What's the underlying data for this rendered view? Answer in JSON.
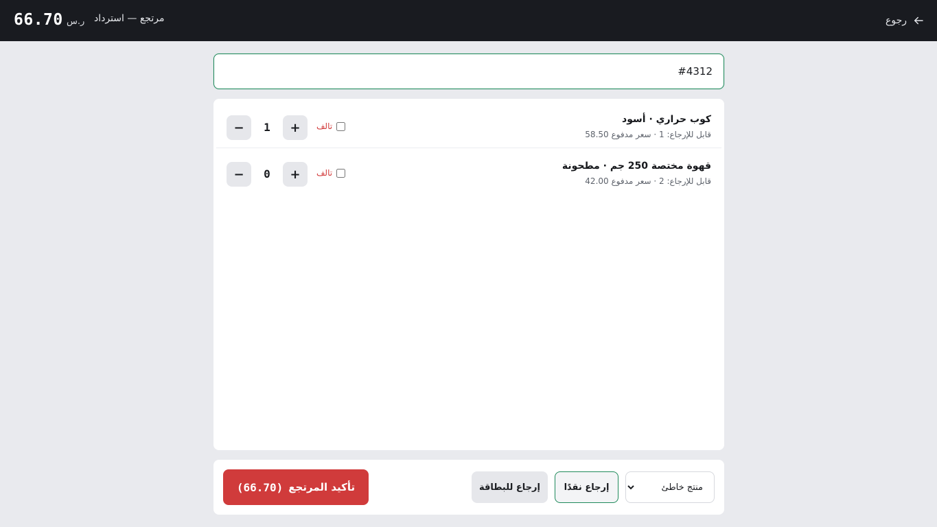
{
  "header": {
    "back_label": "رجوع",
    "title": "مرتجع — استرداد",
    "currency": "ر.س",
    "total": "66.70"
  },
  "receipt": {
    "value": "#4312"
  },
  "items": [
    {
      "name": "كوب حراري · أسود",
      "meta": "قابل للإرجاع: 1 · سعر مدفوع 58.50",
      "qty": "1",
      "damaged_label": "تالف",
      "damaged": false
    },
    {
      "name": "قهوة مختصة 250 جم · مطحونة",
      "meta": "قابل للإرجاع: 2 · سعر مدفوع 42.00",
      "qty": "0",
      "damaged_label": "تالف",
      "damaged": false
    }
  ],
  "qty_controls": {
    "minus": "−",
    "plus": "+"
  },
  "footer": {
    "reason": {
      "selected": "منتج خاطئ",
      "options": [
        "منتج خاطئ"
      ]
    },
    "cash_label": "إرجاع نقدًا",
    "card_label": "إرجاع للبطاقة",
    "confirm_label": "تأكيد المرتجع",
    "confirm_amount": "(66.70)"
  },
  "colors": {
    "header_bg": "#191b20",
    "accent_green": "#1f8a5b",
    "danger_red": "#d03b3b",
    "page_bg": "#e9eaee"
  },
  "icons": {
    "back": "arrow-right-icon"
  }
}
